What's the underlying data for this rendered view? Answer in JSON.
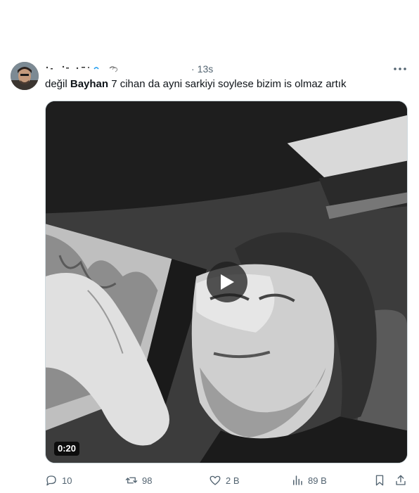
{
  "tweet": {
    "time": "13s",
    "text": {
      "prefix": "değil ",
      "bold": "Bayhan",
      "suffix": " 7 cihan da ayni sarkiyi soylese bizim is olmaz artık"
    },
    "video": {
      "duration": "0:20"
    },
    "actions": {
      "replies": "10",
      "reposts": "98",
      "likes": "2 B",
      "views": "89 B"
    }
  },
  "icons": {
    "more": "more-dots-icon",
    "reply": "reply-icon",
    "repost": "repost-icon",
    "like": "heart-icon",
    "views": "views-icon",
    "bookmark": "bookmark-icon",
    "share": "share-icon",
    "play": "play-icon"
  },
  "colors": {
    "text": "#0f1419",
    "muted": "#536471"
  }
}
